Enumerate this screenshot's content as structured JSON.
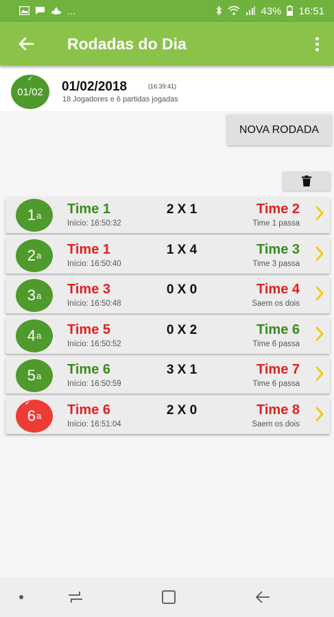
{
  "status_bar": {
    "left_more": "...",
    "battery_percent": "43%",
    "time": "16:51"
  },
  "app_bar": {
    "title": "Rodadas do Dia"
  },
  "day": {
    "badge": "01/02",
    "date": "01/02/2018",
    "time": "(16:39:41)",
    "summary": "18 Jogadores e 6 partidas jogadas"
  },
  "actions": {
    "new_round": "NOVA RODADA",
    "delete_icon": "trash-icon"
  },
  "colors": {
    "green": "#3a8a1c",
    "red": "#e02020",
    "badge_green": "#4e9a2c",
    "badge_red": "#ef3b36",
    "chevron": "#f5c400",
    "app_bar": "#8bc34a"
  },
  "rounds": [
    {
      "num": "1",
      "ord": "a",
      "team_a": "Time 1",
      "team_a_color": "green",
      "score": "2 X 1",
      "team_b": "Time 2",
      "team_b_color": "red",
      "start": "Início: 16:50:32",
      "result": "Time 1 passa",
      "badge_color": "green",
      "checked": false
    },
    {
      "num": "2",
      "ord": "a",
      "team_a": "Time 1",
      "team_a_color": "red",
      "score": "1 X 4",
      "team_b": "Time 3",
      "team_b_color": "green",
      "start": "Início: 16:50:40",
      "result": "Time 3 passa",
      "badge_color": "green",
      "checked": false
    },
    {
      "num": "3",
      "ord": "a",
      "team_a": "Time 3",
      "team_a_color": "red",
      "score": "0 X 0",
      "team_b": "Time 4",
      "team_b_color": "red",
      "start": "Início: 16:50:48",
      "result": "Saem os dois",
      "badge_color": "green",
      "checked": false
    },
    {
      "num": "4",
      "ord": "a",
      "team_a": "Time 5",
      "team_a_color": "red",
      "score": "0 X 2",
      "team_b": "Time 6",
      "team_b_color": "green",
      "start": "Início: 16:50:52",
      "result": "Time 6 passa",
      "badge_color": "green",
      "checked": false
    },
    {
      "num": "5",
      "ord": "a",
      "team_a": "Time 6",
      "team_a_color": "green",
      "score": "3 X 1",
      "team_b": "Time 7",
      "team_b_color": "red",
      "start": "Início: 16:50:59",
      "result": "Time 6 passa",
      "badge_color": "green",
      "checked": false
    },
    {
      "num": "6",
      "ord": "a",
      "team_a": "Time 6",
      "team_a_color": "red",
      "score": "2 X 0",
      "team_b": "Time 8",
      "team_b_color": "red",
      "start": "Início: 16:51:04",
      "result": "Saem os dois",
      "badge_color": "red",
      "checked": true
    }
  ]
}
